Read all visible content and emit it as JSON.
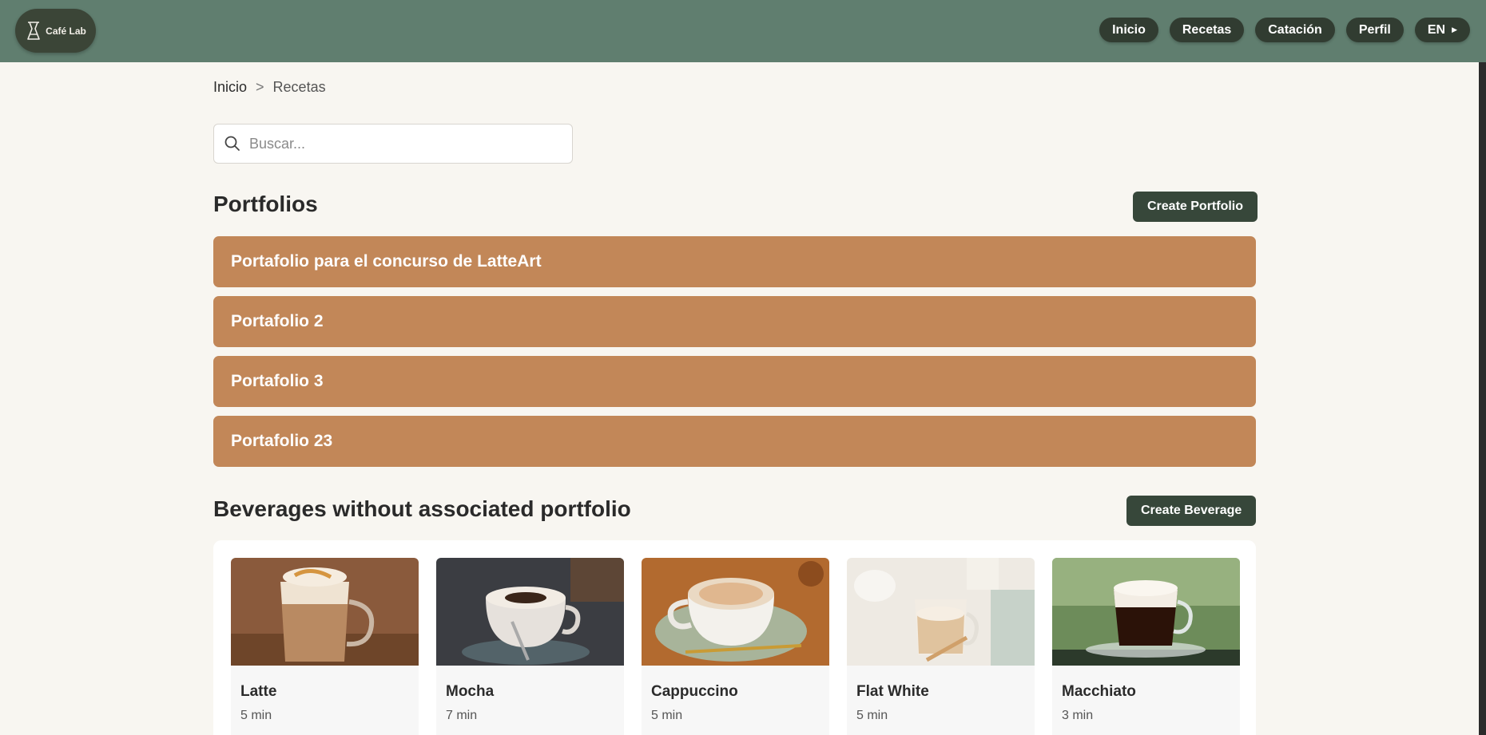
{
  "brand": {
    "name": "Café Lab"
  },
  "nav": {
    "items": [
      {
        "label": "Inicio"
      },
      {
        "label": "Recetas"
      },
      {
        "label": "Catación"
      },
      {
        "label": "Perfil"
      }
    ],
    "language": "EN"
  },
  "breadcrumb": {
    "home": "Inicio",
    "separator": ">",
    "current": "Recetas"
  },
  "search": {
    "placeholder": "Buscar...",
    "value": ""
  },
  "portfolios": {
    "title": "Portfolios",
    "create_label": "Create Portfolio",
    "items": [
      {
        "name": "Portafolio para el concurso de LatteArt"
      },
      {
        "name": "Portafolio 2"
      },
      {
        "name": "Portafolio 3"
      },
      {
        "name": "Portafolio 23"
      }
    ]
  },
  "beverages": {
    "title": "Beverages without associated portfolio",
    "create_label": "Create Beverage",
    "items": [
      {
        "name": "Latte",
        "time": "5 min"
      },
      {
        "name": "Mocha",
        "time": "7 min"
      },
      {
        "name": "Cappuccino",
        "time": "5 min"
      },
      {
        "name": "Flat White",
        "time": "5 min"
      },
      {
        "name": "Macchiato",
        "time": "3 min"
      }
    ]
  },
  "colors": {
    "header": "#607e6f",
    "nav_button": "#313c31",
    "portfolio": "#c28758",
    "primary_button": "#37473a",
    "background": "#f8f6f1"
  }
}
